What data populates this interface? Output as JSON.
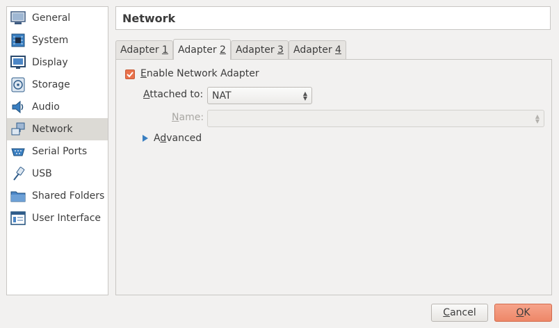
{
  "sidebar": {
    "items": [
      {
        "label": "General",
        "icon": "general-icon",
        "active": false
      },
      {
        "label": "System",
        "icon": "system-icon",
        "active": false
      },
      {
        "label": "Display",
        "icon": "display-icon",
        "active": false
      },
      {
        "label": "Storage",
        "icon": "storage-icon",
        "active": false
      },
      {
        "label": "Audio",
        "icon": "audio-icon",
        "active": false
      },
      {
        "label": "Network",
        "icon": "network-icon",
        "active": true
      },
      {
        "label": "Serial Ports",
        "icon": "serial-ports-icon",
        "active": false
      },
      {
        "label": "USB",
        "icon": "usb-icon",
        "active": false
      },
      {
        "label": "Shared Folders",
        "icon": "shared-folders-icon",
        "active": false
      },
      {
        "label": "User Interface",
        "icon": "user-interface-icon",
        "active": false
      }
    ]
  },
  "header": {
    "title": "Network"
  },
  "tabs": [
    {
      "prefix": "Adapter ",
      "key": "1",
      "active": false
    },
    {
      "prefix": "Adapter ",
      "key": "2",
      "active": true
    },
    {
      "prefix": "Adapter ",
      "key": "3",
      "active": false
    },
    {
      "prefix": "Adapter ",
      "key": "4",
      "active": false
    }
  ],
  "adapter": {
    "enable_key": "E",
    "enable_rest": "nable Network Adapter",
    "enabled": true,
    "attached_key": "A",
    "attached_rest": "ttached to:",
    "attached_value": "NAT",
    "name_key": "N",
    "name_rest": "ame:",
    "name_value": "",
    "advanced_pre": "A",
    "advanced_key": "d",
    "advanced_rest": "vanced"
  },
  "buttons": {
    "cancel_key": "C",
    "cancel_rest": "ancel",
    "ok_key": "O",
    "ok_rest": "K"
  },
  "colors": {
    "accent": "#e9714b",
    "selection": "#dcdad5",
    "window": "#f2f1f0"
  }
}
